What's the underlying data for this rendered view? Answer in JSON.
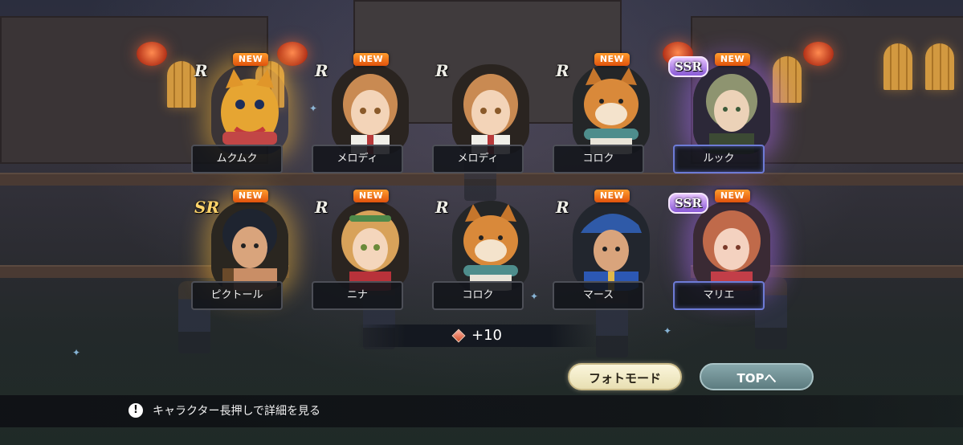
{
  "reward": {
    "text": "+10"
  },
  "buttons": {
    "photo_mode": "フォトモード",
    "top": "TOPへ"
  },
  "hint": {
    "text": "キャラクター長押しで詳細を見る"
  },
  "new_label": "NEW",
  "cards": [
    {
      "name": "ムクムク",
      "rarity": "R",
      "is_new": true
    },
    {
      "name": "メロディ",
      "rarity": "R",
      "is_new": true
    },
    {
      "name": "メロディ",
      "rarity": "R",
      "is_new": false
    },
    {
      "name": "コロク",
      "rarity": "R",
      "is_new": true
    },
    {
      "name": "ルック",
      "rarity": "SSR",
      "is_new": true
    },
    {
      "name": "ピクトール",
      "rarity": "SR",
      "is_new": true
    },
    {
      "name": "ニナ",
      "rarity": "R",
      "is_new": true
    },
    {
      "name": "コロク",
      "rarity": "R",
      "is_new": false
    },
    {
      "name": "マース",
      "rarity": "R",
      "is_new": true
    },
    {
      "name": "マリエ",
      "rarity": "SSR",
      "is_new": true
    }
  ],
  "icons": {
    "reward": "crest-gem-icon",
    "hint": "exclamation-circle-icon"
  },
  "colors": {
    "new_badge": "#f07a1c",
    "ssr_glow": "#b46eff",
    "sr_glow": "#ffbe3c"
  }
}
